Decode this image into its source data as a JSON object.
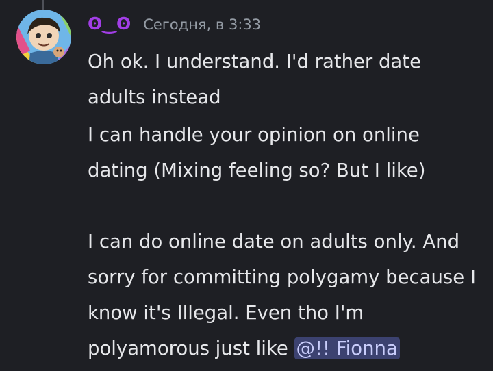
{
  "message": {
    "author": "ʘ‿ʘ",
    "timestamp": "Сегодня, в 3:33",
    "paragraphs": [
      "Oh ok. I understand. I'd rather date adults instead",
      "I can handle your opinion on online dating (Mixing feeling so? But I like)",
      "I can do online date on adults only. And sorry for committing polygamy because I know it's Illegal. Even tho I'm polyamorous just like"
    ],
    "mention": "@!! Fionna"
  },
  "colors": {
    "background": "#1e1f24",
    "username": "#a23ee6",
    "timestamp": "#949ba4",
    "text": "#e6e7ea",
    "mention_bg": "#3c4270",
    "mention_text": "#c9cdfb"
  },
  "icons": {
    "avatar": "user-avatar-icon"
  }
}
